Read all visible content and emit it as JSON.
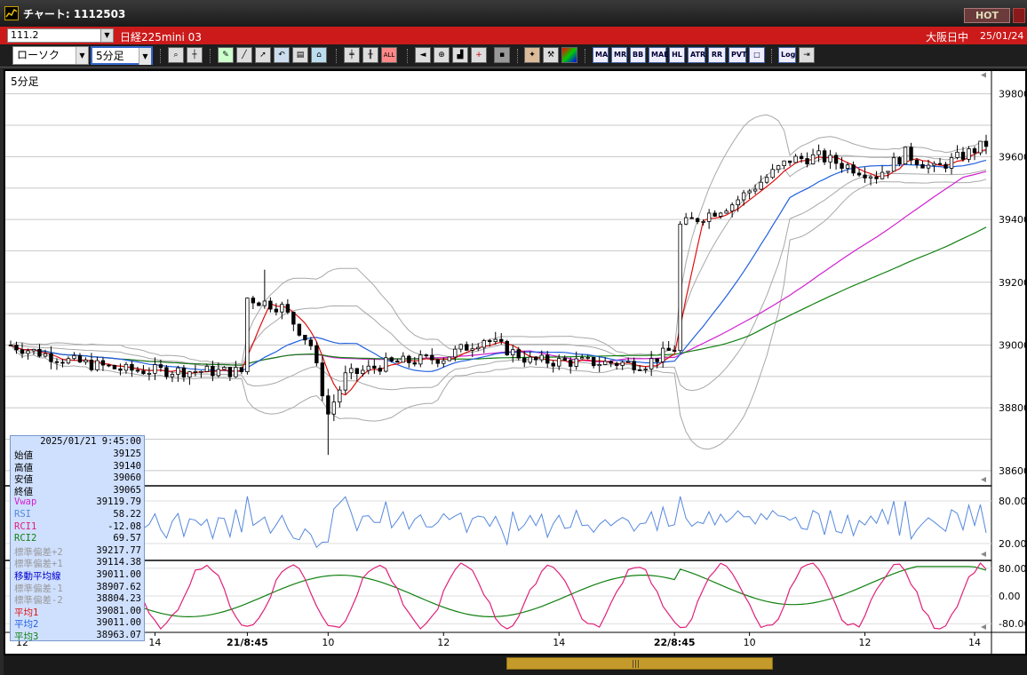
{
  "window": {
    "title": "チャート: 1112503",
    "hot_label": "HOT"
  },
  "symbol_bar": {
    "code": "111.2",
    "name": "日経225mini 03",
    "status": "大阪日中",
    "date": "25/01/24"
  },
  "toolbar": {
    "chart_type": "ローソク",
    "period": "5分足",
    "text_buttons": [
      "MA",
      "MR",
      "BB",
      "MAE",
      "HL",
      "ATR",
      "RR",
      "PVT",
      "□",
      "Log"
    ]
  },
  "chart": {
    "timeframe_label": "5分足",
    "price_ticks": [
      "39800",
      "39600",
      "39400",
      "39200",
      "39000",
      "38800",
      "38600"
    ],
    "rsi_ticks": [
      "80.00",
      "20.00"
    ],
    "rci_ticks": [
      "80.00",
      "0.00",
      "-80.00"
    ],
    "x_labels": [
      "12",
      "14",
      "21/8:45",
      "10",
      "12",
      "14",
      "22/8:45",
      "10",
      "12",
      "14"
    ],
    "colors": {
      "up": "#ffffff",
      "down": "#000000",
      "vwap": "#d020d0",
      "ma1": "#e01010",
      "ma2": "#2060e0",
      "ma3": "#108010",
      "bb": "#a8a8a8",
      "rsi": "#5588dd",
      "rci1": "#e0207a",
      "rci2": "#108010"
    }
  },
  "info": {
    "datetime": "2025/01/21 9:45:00",
    "rows": [
      {
        "k": "始値",
        "v": "39125",
        "c": "#000"
      },
      {
        "k": "高値",
        "v": "39140",
        "c": "#000"
      },
      {
        "k": "安値",
        "v": "39060",
        "c": "#000"
      },
      {
        "k": "終値",
        "v": "39065",
        "c": "#000"
      },
      {
        "k": "Vwap",
        "v": "39119.79",
        "c": "#d020d0"
      },
      {
        "k": "RSI",
        "v": "58.22",
        "c": "#5588dd"
      },
      {
        "k": "RCI1",
        "v": "-12.08",
        "c": "#e0207a"
      },
      {
        "k": "RCI2",
        "v": "69.57",
        "c": "#108010"
      },
      {
        "k": "標準偏差+2",
        "v": "39217.77",
        "c": "#999"
      },
      {
        "k": "標準偏差+1",
        "v": "39114.38",
        "c": "#999"
      },
      {
        "k": "移動平均線",
        "v": "39011.00",
        "c": "#0000cc"
      },
      {
        "k": "標準偏差-1",
        "v": "38907.62",
        "c": "#999"
      },
      {
        "k": "標準偏差-2",
        "v": "38804.23",
        "c": "#999"
      },
      {
        "k": "平均1",
        "v": "39081.00",
        "c": "#e01010"
      },
      {
        "k": "平均2",
        "v": "39011.00",
        "c": "#2060e0"
      },
      {
        "k": "平均3",
        "v": "38963.07",
        "c": "#108010"
      }
    ]
  }
}
